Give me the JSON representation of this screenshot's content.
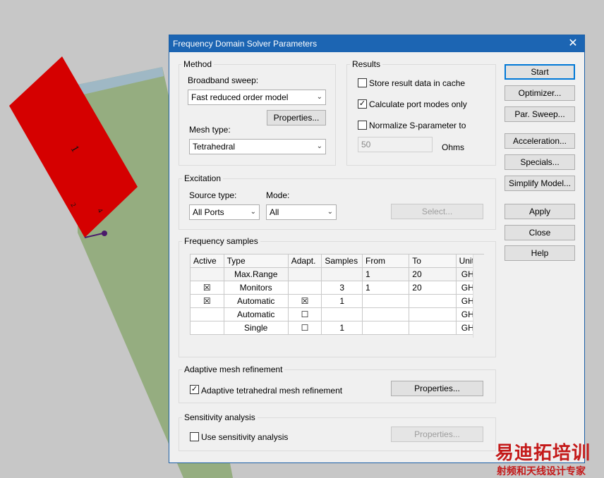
{
  "dialog": {
    "title": "Frequency Domain Solver Parameters",
    "close_glyph": "✕"
  },
  "method": {
    "label": "Method",
    "broadband_label": "Broadband sweep:",
    "broadband_value": "Fast reduced order model",
    "properties_button": "Properties...",
    "mesh_type_label": "Mesh type:",
    "mesh_type_value": "Tetrahedral"
  },
  "results": {
    "label": "Results",
    "store_cache": {
      "label": "Store result data in cache",
      "checked": false
    },
    "port_modes": {
      "label": "Calculate port modes only",
      "checked": true
    },
    "normalize": {
      "label": "Normalize S-parameter to",
      "checked": false
    },
    "ohms_value": "50",
    "ohms_unit": "Ohms"
  },
  "excitation": {
    "label": "Excitation",
    "source_type_label": "Source type:",
    "source_type_value": "All Ports",
    "mode_label": "Mode:",
    "mode_value": "All",
    "select_button": "Select..."
  },
  "frequency_samples": {
    "label": "Frequency samples",
    "columns": [
      "Active",
      "Type",
      "Adapt.",
      "Samples",
      "From",
      "To",
      "Unit"
    ],
    "rows": [
      {
        "active": "",
        "type": "Max.Range",
        "adapt": "",
        "samples": "",
        "from": "1",
        "to": "20",
        "unit": "GHz"
      },
      {
        "active": "☒",
        "type": "Monitors",
        "adapt": "",
        "samples": "3",
        "from": "1",
        "to": "20",
        "unit": "GHz"
      },
      {
        "active": "☒",
        "type": "Automatic",
        "adapt": "☒",
        "samples": "1",
        "from": "",
        "to": "",
        "unit": "GHz"
      },
      {
        "active": "",
        "type": "Automatic",
        "adapt": "☐",
        "samples": "",
        "from": "",
        "to": "",
        "unit": "GHz"
      },
      {
        "active": "",
        "type": "Single",
        "adapt": "☐",
        "samples": "1",
        "from": "",
        "to": "",
        "unit": "GHz"
      }
    ]
  },
  "adaptive_mesh": {
    "label": "Adaptive mesh refinement",
    "checkbox_label": "Adaptive tetrahedral mesh refinement",
    "checked": true,
    "properties_button": "Properties..."
  },
  "sensitivity": {
    "label": "Sensitivity analysis",
    "checkbox_label": "Use sensitivity analysis",
    "checked": false,
    "properties_button": "Properties..."
  },
  "side_buttons": {
    "start": "Start",
    "optimizer": "Optimizer...",
    "par_sweep": "Par. Sweep...",
    "acceleration": "Acceleration...",
    "specials": "Specials...",
    "simplify_model": "Simplify Model...",
    "apply": "Apply",
    "close": "Close",
    "help": "Help"
  },
  "background": {
    "port_labels": [
      "1",
      "2",
      "4"
    ]
  },
  "watermark": {
    "line1": "易迪拓培训",
    "line2": "射频和天线设计专家"
  }
}
